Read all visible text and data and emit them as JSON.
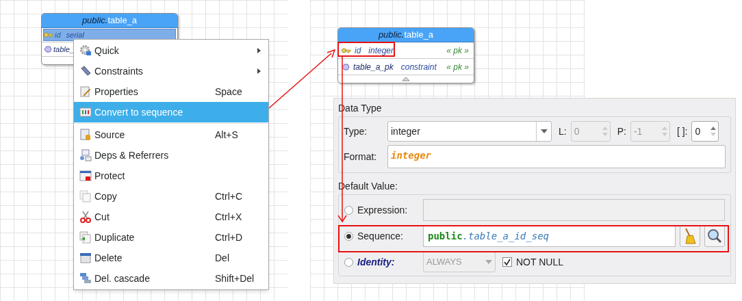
{
  "left_diagram": {
    "table": {
      "schema": "public.",
      "name": "table_a",
      "columns": [
        {
          "name": "id",
          "type": "serial",
          "kind": "pk",
          "selected": true
        },
        {
          "name": "table_",
          "kind": "constraint",
          "selected": false
        }
      ]
    }
  },
  "context_menu": {
    "groups": [
      [
        {
          "label": "Quick",
          "submenu": true,
          "selected": false
        },
        {
          "label": "Constraints",
          "submenu": true,
          "selected": false
        },
        {
          "label": "Properties",
          "shortcut": "Space",
          "submenu": false,
          "selected": false
        },
        {
          "label": "Convert to sequence",
          "submenu": false,
          "selected": true
        }
      ],
      [
        {
          "label": "Source",
          "shortcut": "Alt+S",
          "submenu": false,
          "selected": false
        },
        {
          "label": "Deps & Referrers",
          "submenu": false,
          "selected": false
        },
        {
          "label": "Protect",
          "submenu": false,
          "selected": false
        },
        {
          "label": "Copy",
          "shortcut": "Ctrl+C",
          "submenu": false,
          "selected": false
        },
        {
          "label": "Cut",
          "shortcut": "Ctrl+X",
          "submenu": false,
          "selected": false
        },
        {
          "label": "Duplicate",
          "shortcut": "Ctrl+D",
          "submenu": false,
          "selected": false
        },
        {
          "label": "Delete",
          "shortcut": "Del",
          "submenu": false,
          "selected": false
        },
        {
          "label": "Del. cascade",
          "shortcut": "Shift+Del",
          "submenu": false,
          "selected": false
        }
      ]
    ]
  },
  "right_diagram": {
    "table": {
      "schema": "public.",
      "name": "table_a",
      "columns": [
        {
          "name": "id",
          "type": "integer",
          "tag": "« pk »",
          "kind": "pk",
          "selected": false
        },
        {
          "name": "table_a_pk",
          "type": "constraint",
          "tag": "« pk »",
          "kind": "constraint",
          "selected": false
        }
      ]
    }
  },
  "column_panel": {
    "data_type": {
      "title": "Data Type",
      "type_label": "Type:",
      "type_value": "integer",
      "spinners": [
        {
          "label": "L:",
          "value": "0",
          "disabled": true
        },
        {
          "label": "P:",
          "value": "-1",
          "disabled": true
        },
        {
          "label": "[ ]:",
          "value": "0",
          "disabled": false
        }
      ],
      "format_label": "Format:",
      "format_value": "integer"
    },
    "default_value": {
      "title": "Default Value:",
      "options": [
        {
          "kind": "expression",
          "label": "Expression:",
          "selected": false
        },
        {
          "kind": "sequence",
          "label": "Sequence:",
          "selected": true,
          "schema": "public",
          "name": ".table_a_id_seq"
        },
        {
          "kind": "identity",
          "label": "Identity:",
          "selected": false,
          "value": "ALWAYS"
        }
      ],
      "not_null": {
        "label": "NOT NULL",
        "checked": true
      }
    }
  }
}
